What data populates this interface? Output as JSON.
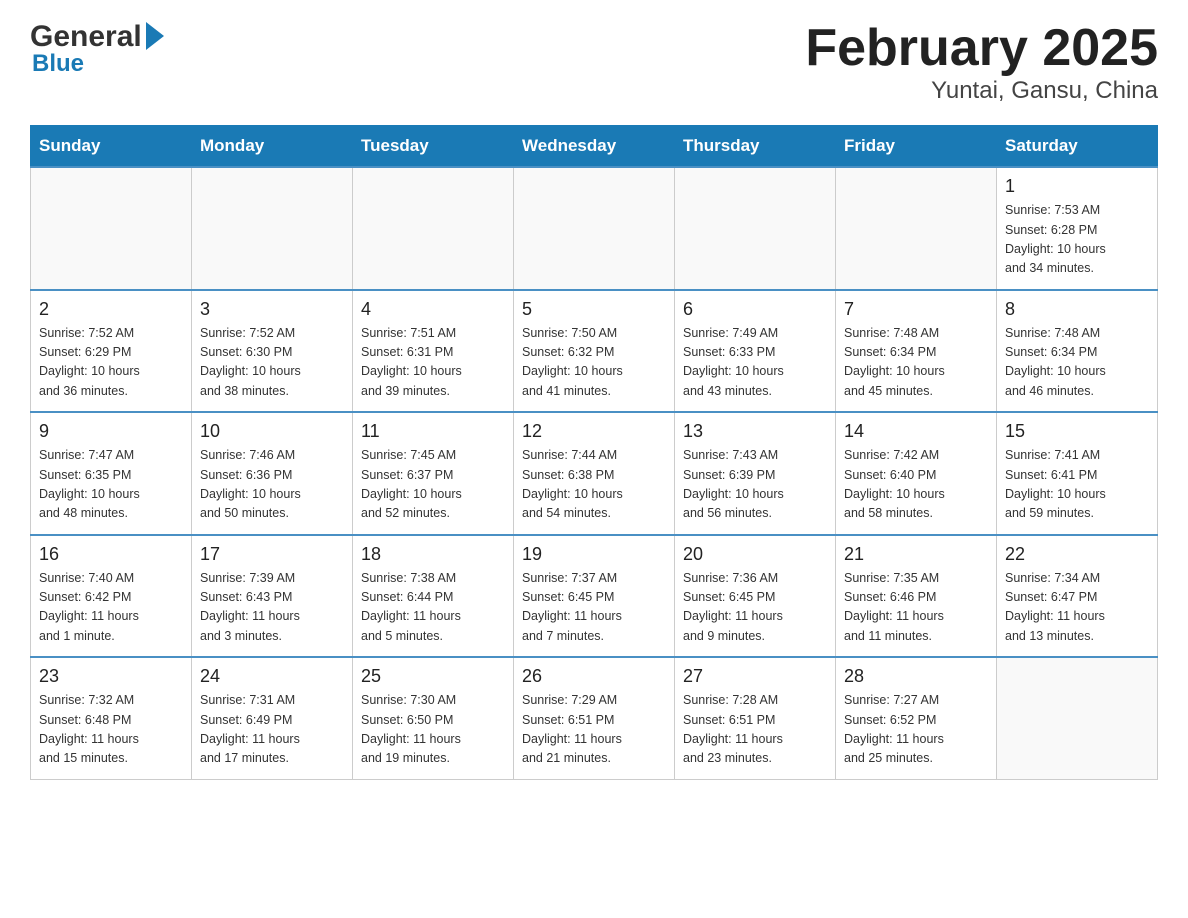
{
  "logo": {
    "general": "General",
    "blue": "Blue"
  },
  "title": "February 2025",
  "subtitle": "Yuntai, Gansu, China",
  "weekdays": [
    "Sunday",
    "Monday",
    "Tuesday",
    "Wednesday",
    "Thursday",
    "Friday",
    "Saturday"
  ],
  "weeks": [
    [
      {
        "day": "",
        "info": ""
      },
      {
        "day": "",
        "info": ""
      },
      {
        "day": "",
        "info": ""
      },
      {
        "day": "",
        "info": ""
      },
      {
        "day": "",
        "info": ""
      },
      {
        "day": "",
        "info": ""
      },
      {
        "day": "1",
        "info": "Sunrise: 7:53 AM\nSunset: 6:28 PM\nDaylight: 10 hours\nand 34 minutes."
      }
    ],
    [
      {
        "day": "2",
        "info": "Sunrise: 7:52 AM\nSunset: 6:29 PM\nDaylight: 10 hours\nand 36 minutes."
      },
      {
        "day": "3",
        "info": "Sunrise: 7:52 AM\nSunset: 6:30 PM\nDaylight: 10 hours\nand 38 minutes."
      },
      {
        "day": "4",
        "info": "Sunrise: 7:51 AM\nSunset: 6:31 PM\nDaylight: 10 hours\nand 39 minutes."
      },
      {
        "day": "5",
        "info": "Sunrise: 7:50 AM\nSunset: 6:32 PM\nDaylight: 10 hours\nand 41 minutes."
      },
      {
        "day": "6",
        "info": "Sunrise: 7:49 AM\nSunset: 6:33 PM\nDaylight: 10 hours\nand 43 minutes."
      },
      {
        "day": "7",
        "info": "Sunrise: 7:48 AM\nSunset: 6:34 PM\nDaylight: 10 hours\nand 45 minutes."
      },
      {
        "day": "8",
        "info": "Sunrise: 7:48 AM\nSunset: 6:34 PM\nDaylight: 10 hours\nand 46 minutes."
      }
    ],
    [
      {
        "day": "9",
        "info": "Sunrise: 7:47 AM\nSunset: 6:35 PM\nDaylight: 10 hours\nand 48 minutes."
      },
      {
        "day": "10",
        "info": "Sunrise: 7:46 AM\nSunset: 6:36 PM\nDaylight: 10 hours\nand 50 minutes."
      },
      {
        "day": "11",
        "info": "Sunrise: 7:45 AM\nSunset: 6:37 PM\nDaylight: 10 hours\nand 52 minutes."
      },
      {
        "day": "12",
        "info": "Sunrise: 7:44 AM\nSunset: 6:38 PM\nDaylight: 10 hours\nand 54 minutes."
      },
      {
        "day": "13",
        "info": "Sunrise: 7:43 AM\nSunset: 6:39 PM\nDaylight: 10 hours\nand 56 minutes."
      },
      {
        "day": "14",
        "info": "Sunrise: 7:42 AM\nSunset: 6:40 PM\nDaylight: 10 hours\nand 58 minutes."
      },
      {
        "day": "15",
        "info": "Sunrise: 7:41 AM\nSunset: 6:41 PM\nDaylight: 10 hours\nand 59 minutes."
      }
    ],
    [
      {
        "day": "16",
        "info": "Sunrise: 7:40 AM\nSunset: 6:42 PM\nDaylight: 11 hours\nand 1 minute."
      },
      {
        "day": "17",
        "info": "Sunrise: 7:39 AM\nSunset: 6:43 PM\nDaylight: 11 hours\nand 3 minutes."
      },
      {
        "day": "18",
        "info": "Sunrise: 7:38 AM\nSunset: 6:44 PM\nDaylight: 11 hours\nand 5 minutes."
      },
      {
        "day": "19",
        "info": "Sunrise: 7:37 AM\nSunset: 6:45 PM\nDaylight: 11 hours\nand 7 minutes."
      },
      {
        "day": "20",
        "info": "Sunrise: 7:36 AM\nSunset: 6:45 PM\nDaylight: 11 hours\nand 9 minutes."
      },
      {
        "day": "21",
        "info": "Sunrise: 7:35 AM\nSunset: 6:46 PM\nDaylight: 11 hours\nand 11 minutes."
      },
      {
        "day": "22",
        "info": "Sunrise: 7:34 AM\nSunset: 6:47 PM\nDaylight: 11 hours\nand 13 minutes."
      }
    ],
    [
      {
        "day": "23",
        "info": "Sunrise: 7:32 AM\nSunset: 6:48 PM\nDaylight: 11 hours\nand 15 minutes."
      },
      {
        "day": "24",
        "info": "Sunrise: 7:31 AM\nSunset: 6:49 PM\nDaylight: 11 hours\nand 17 minutes."
      },
      {
        "day": "25",
        "info": "Sunrise: 7:30 AM\nSunset: 6:50 PM\nDaylight: 11 hours\nand 19 minutes."
      },
      {
        "day": "26",
        "info": "Sunrise: 7:29 AM\nSunset: 6:51 PM\nDaylight: 11 hours\nand 21 minutes."
      },
      {
        "day": "27",
        "info": "Sunrise: 7:28 AM\nSunset: 6:51 PM\nDaylight: 11 hours\nand 23 minutes."
      },
      {
        "day": "28",
        "info": "Sunrise: 7:27 AM\nSunset: 6:52 PM\nDaylight: 11 hours\nand 25 minutes."
      },
      {
        "day": "",
        "info": ""
      }
    ]
  ]
}
